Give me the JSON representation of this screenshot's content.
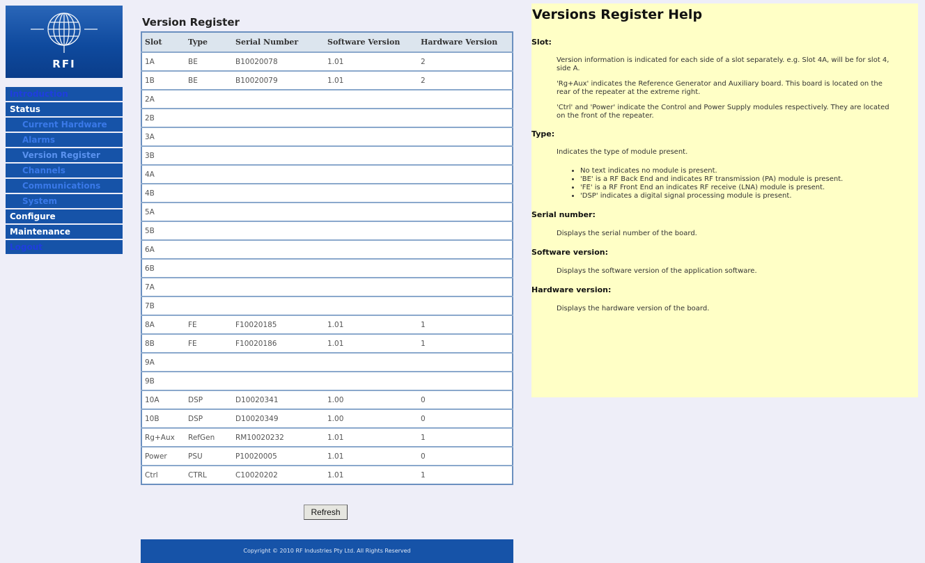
{
  "logo": {
    "text": "RFI"
  },
  "nav": {
    "introduction": "Introduction",
    "status": "Status",
    "current_hardware": "Current Hardware",
    "alarms": "Alarms",
    "version_register": "Version Register",
    "channels": "Channels",
    "communications": "Communications",
    "system": "System",
    "configure": "Configure",
    "maintenance": "Maintenance",
    "logout": "Logout"
  },
  "page": {
    "title": "Version Register"
  },
  "table": {
    "headers": [
      "Slot",
      "Type",
      "Serial Number",
      "Software Version",
      "Hardware Version"
    ],
    "rows": [
      [
        "1A",
        "BE",
        "B10020078",
        "1.01",
        "2"
      ],
      [
        "1B",
        "BE",
        "B10020079",
        "1.01",
        "2"
      ],
      [
        "2A",
        "",
        "",
        "",
        ""
      ],
      [
        "2B",
        "",
        "",
        "",
        ""
      ],
      [
        "3A",
        "",
        "",
        "",
        ""
      ],
      [
        "3B",
        "",
        "",
        "",
        ""
      ],
      [
        "4A",
        "",
        "",
        "",
        ""
      ],
      [
        "4B",
        "",
        "",
        "",
        ""
      ],
      [
        "5A",
        "",
        "",
        "",
        ""
      ],
      [
        "5B",
        "",
        "",
        "",
        ""
      ],
      [
        "6A",
        "",
        "",
        "",
        ""
      ],
      [
        "6B",
        "",
        "",
        "",
        ""
      ],
      [
        "7A",
        "",
        "",
        "",
        ""
      ],
      [
        "7B",
        "",
        "",
        "",
        ""
      ],
      [
        "8A",
        "FE",
        "F10020185",
        "1.01",
        "1"
      ],
      [
        "8B",
        "FE",
        "F10020186",
        "1.01",
        "1"
      ],
      [
        "9A",
        "",
        "",
        "",
        ""
      ],
      [
        "9B",
        "",
        "",
        "",
        ""
      ],
      [
        "10A",
        "DSP",
        "D10020341",
        "1.00",
        "0"
      ],
      [
        "10B",
        "DSP",
        "D10020349",
        "1.00",
        "0"
      ],
      [
        "Rg+Aux",
        "RefGen",
        "RM10020232",
        "1.01",
        "1"
      ],
      [
        "Power",
        "PSU",
        "P10020005",
        "1.01",
        "0"
      ],
      [
        "Ctrl",
        "CTRL",
        "C10020202",
        "1.01",
        "1"
      ]
    ]
  },
  "refresh_label": "Refresh",
  "footer": "Copyright © 2010 RF Industries Pty Ltd. All Rights Reserved",
  "help": {
    "title": "Versions Register Help",
    "slot_heading": "Slot:",
    "slot_p1": "Version information is indicated for each side of a slot separately. e.g. Slot 4A, will be for slot 4, side A.",
    "slot_p2": "'Rg+Aux' indicates the Reference Generator and Auxiliary board. This board is located on the rear of the repeater at the extreme right.",
    "slot_p3": "'Ctrl' and 'Power' indicate the Control and Power Supply modules respectively. They are located on the front of the repeater.",
    "type_heading": "Type:",
    "type_p1": "Indicates the type of module present.",
    "type_items": [
      "No text indicates no module is present.",
      "'BE' is a RF Back End and indicates RF transmission (PA) module is present.",
      "'FE' is a RF Front End an indicates RF receive (LNA) module is present.",
      "'DSP' indicates a digital signal processing module is present."
    ],
    "serial_heading": "Serial number:",
    "serial_p": "Displays the serial number of the board.",
    "software_heading": "Software version:",
    "software_p": "Displays the software version of the application software.",
    "hardware_heading": "Hardware version:",
    "hardware_p": "Displays the hardware version of the board."
  },
  "colors": {
    "nav_bg": "#1653a8",
    "help_bg": "#ffffc6",
    "page_bg": "#eeeef8",
    "table_border": "#6a8fbf",
    "header_bg": "#dce5ee"
  }
}
